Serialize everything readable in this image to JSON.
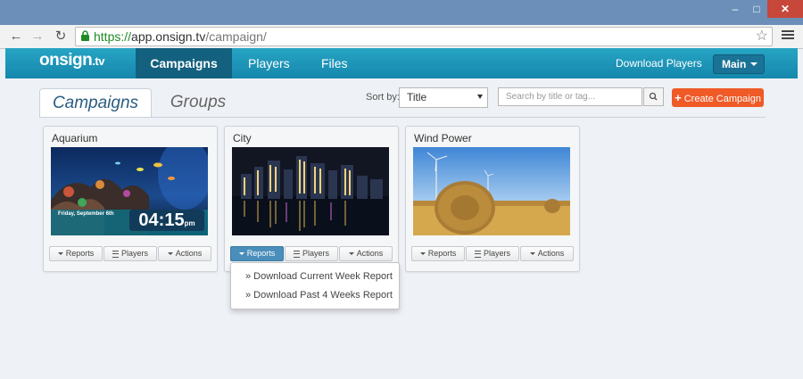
{
  "browser": {
    "url_scheme": "https://",
    "url_host": "app.onsign.tv",
    "url_path": "/campaign/",
    "window_controls": {
      "minimize": "–",
      "maximize": "□",
      "close": "✕"
    }
  },
  "app": {
    "logo_text": "onsign",
    "logo_suffix": ".tv",
    "nav": [
      {
        "label": "Campaigns",
        "active": true
      },
      {
        "label": "Players",
        "active": false
      },
      {
        "label": "Files",
        "active": false
      }
    ],
    "download_players": "Download Players",
    "account_dropdown": "Main"
  },
  "toolbar": {
    "tabs": [
      {
        "label": "Campaigns",
        "active": true
      },
      {
        "label": "Groups",
        "active": false
      }
    ],
    "sort_label": "Sort by:",
    "sort_value": "Title",
    "search_placeholder": "Search by title or tag...",
    "create_label": "Create Campaign",
    "create_plus": "+"
  },
  "campaigns": [
    {
      "title": "Aquarium",
      "overlay_date": "Friday, September 6th",
      "overlay_time": "04:15",
      "overlay_ampm": "pm"
    },
    {
      "title": "City"
    },
    {
      "title": "Wind Power"
    }
  ],
  "card_actions": {
    "reports": "Reports",
    "players": "Players",
    "actions": "Actions"
  },
  "reports_menu": [
    "» Download Current Week Report",
    "» Download Past 4 Weeks Report"
  ],
  "colors": {
    "appbar": "#1a93b8",
    "active_nav": "#13617e",
    "create_button": "#ef5a27",
    "active_reports": "#4a8ebb"
  }
}
